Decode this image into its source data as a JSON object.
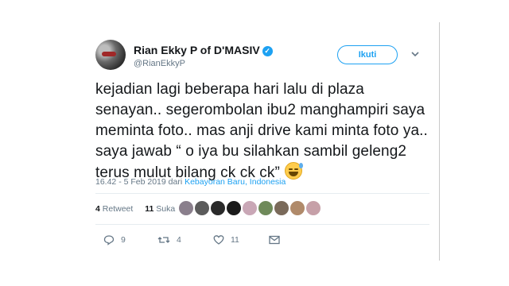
{
  "tweet": {
    "author_name": "Rian Ekky P of D'MASIV",
    "handle": "@RianEkkyP",
    "follow_label": "Ikuti",
    "text": "kejadian lagi beberapa hari lalu di plaza senayan.. segerombolan ibu2 manghampiri saya meminta foto.. mas anji drive kami minta foto ya.. saya jawab “ o iya bu silahkan sambil geleng2 terus mulut bilang ck ck ck”",
    "emoji": "grinning-face-with-sweat",
    "timestamp": "16.42 - 5 Feb 2019",
    "from_word": "dari",
    "location": "Kebayoran Baru, Indonesia",
    "retweet_count": "4",
    "retweet_label": "Retweet",
    "like_count": "11",
    "like_label": "Suka",
    "reply_count": "9",
    "retweet_action_count": "4",
    "like_action_count": "11"
  },
  "liker_avatars": [
    {
      "name": "liker-avatar-1",
      "color": "#8a7f8c"
    },
    {
      "name": "liker-avatar-2",
      "color": "#5b5b5b"
    },
    {
      "name": "liker-avatar-3",
      "color": "#2a2a2a"
    },
    {
      "name": "liker-avatar-4",
      "color": "#1b1b1b"
    },
    {
      "name": "liker-avatar-5",
      "color": "#c9a7b6"
    },
    {
      "name": "liker-avatar-6",
      "color": "#6f8a5a"
    },
    {
      "name": "liker-avatar-7",
      "color": "#7a6a5a"
    },
    {
      "name": "liker-avatar-8",
      "color": "#b08a6a"
    },
    {
      "name": "liker-avatar-9",
      "color": "#c6a0a8"
    }
  ],
  "colors": {
    "accent": "#1da1f2",
    "text": "#14171a",
    "muted": "#657786"
  }
}
